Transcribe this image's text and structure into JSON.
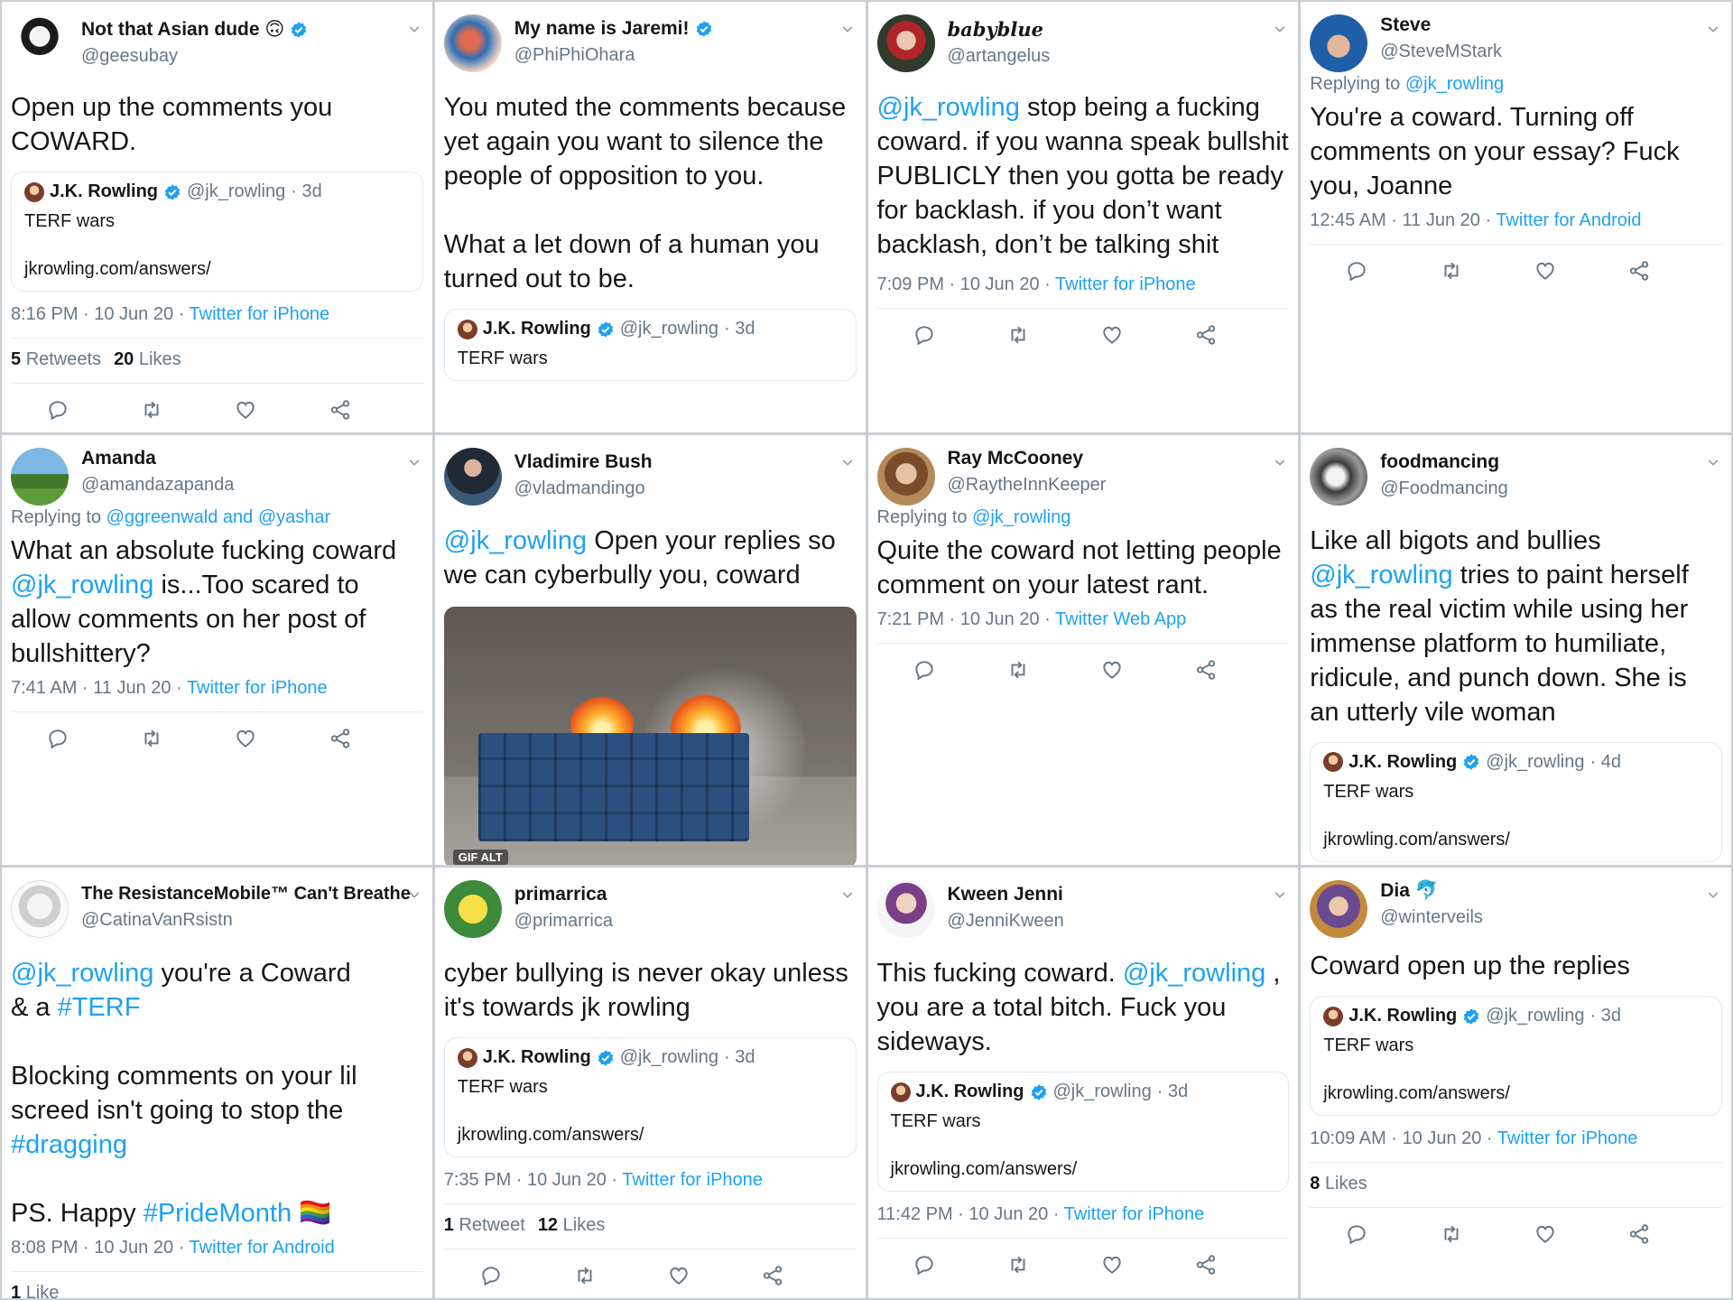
{
  "icons": {
    "verified": "verified-badge-icon",
    "chevron": "chevron-down-icon",
    "reply": "reply-icon",
    "retweet": "retweet-icon",
    "like": "heart-icon",
    "share": "share-icon"
  },
  "colors": {
    "link": "#1da1f2",
    "muted": "#657786",
    "verified": "#1da1f2"
  },
  "quote": {
    "name": "J.K. Rowling",
    "handle": "@jk_rowling",
    "text": "TERF wars",
    "link": "jkrowling.com/answers/"
  },
  "tweets": [
    {
      "name": "Not that Asian dude 🙃",
      "handle": "@geesubay",
      "body": "Open up the comments you COWARD.",
      "quote_meta": " · 3d",
      "time": "8:16 PM · 10 Jun 20 · ",
      "client": "Twitter for iPhone",
      "stat1_num": "5",
      "stat1_label": "Retweets",
      "stat2_num": "20",
      "stat2_label": "Likes"
    },
    {
      "name": "My name is Jaremi!",
      "handle": "@PhiPhiOhara",
      "body": "You muted the comments because yet again you want to silence the people of opposition to you.\n\nWhat a let down of a human you turned out to be.",
      "quote_meta": " · 3d"
    },
    {
      "name": "babyblue",
      "handle": "@artangelus",
      "mention": "@jk_rowling",
      "body": " stop being a fucking coward. if you wanna speak bullshit PUBLICLY then you gotta be ready for backlash. if you don’t want backlash, don’t be talking shit",
      "time": "7:09 PM · 10 Jun 20 · ",
      "client": "Twitter for iPhone"
    },
    {
      "name": "Steve",
      "handle": "@SteveMStark",
      "reply_prefix": "Replying to ",
      "reply_to": "@jk_rowling",
      "body": "You're a coward. Turning off comments on your essay? Fuck you, Joanne",
      "time": "12:45 AM · 11 Jun 20 · ",
      "client": "Twitter for Android"
    },
    {
      "name": "Amanda",
      "handle": "@amandazapanda",
      "reply_prefix": "Replying to ",
      "reply_to": "@ggreenwald and @yashar",
      "body_a": "What an absolute fucking coward ",
      "mention": "@jk_rowling",
      "body_b": " is...Too scared to allow comments on her post of bullshittery?",
      "time": "7:41 AM · 11 Jun 20 · ",
      "client": "Twitter for iPhone"
    },
    {
      "name": "Vladimire Bush",
      "handle": "@vladmandingo",
      "mention": "@jk_rowling",
      "body": " Open your replies so we can cyberbully you, coward",
      "media_badge": "GIF  ALT"
    },
    {
      "name": "Ray McCooney",
      "handle": "@RaytheInnKeeper",
      "reply_prefix": "Replying to ",
      "reply_to": "@jk_rowling",
      "body": "Quite the coward not letting people comment on your latest rant.",
      "time": "7:21 PM · 10 Jun 20 · ",
      "client": "Twitter Web App"
    },
    {
      "name": "foodmancing",
      "handle": "@Foodmancing",
      "body_a": "Like all bigots and bullies ",
      "mention": "@jk_rowling",
      "body_b": " tries to paint herself as the real victim while using her immense platform to humiliate, ridicule, and punch down. She is an utterly vile woman",
      "quote_meta": " · 4d"
    },
    {
      "name": "The ResistanceMobile™ Can't Breathe",
      "handle": "@CatinaVanRsistn",
      "mention": "@jk_rowling",
      "body_a": " you're a Coward\n& a ",
      "tag1": "#TERF",
      "body_b": "\n\nBlocking comments on your lil screed isn't going to stop the\n",
      "tag2": "#dragging",
      "body_c": "\n\nPS. Happy ",
      "tag3": "#PrideMonth",
      "body_d": " 🏳️‍🌈",
      "time": "8:08 PM · 10 Jun 20 · ",
      "client": "Twitter for Android",
      "stat1_num": "1",
      "stat1_label": "Like"
    },
    {
      "name": "primarrica",
      "handle": "@primarrica",
      "body": "cyber bullying is never okay unless it's towards jk rowling",
      "quote_meta": " · 3d",
      "time": "7:35 PM · 10 Jun 20 · ",
      "client": "Twitter for iPhone",
      "stat1_num": "1",
      "stat1_label": "Retweet",
      "stat2_num": "12",
      "stat2_label": "Likes"
    },
    {
      "name": "Kween Jenni",
      "handle": "@JenniKween",
      "body_a": "This fucking coward. ",
      "mention": "@jk_rowling",
      "body_b": " , you are a total bitch. Fuck you sideways.",
      "quote_meta": " · 3d",
      "time": "11:42 PM · 10 Jun 20 · ",
      "client": "Twitter for iPhone"
    },
    {
      "name": "Dia 🐬",
      "handle": "@winterveils",
      "body": "Coward open up the replies",
      "quote_meta": " · 3d",
      "time": "10:09 AM · 10 Jun 20 · ",
      "client": "Twitter for iPhone",
      "stat1_num": "8",
      "stat1_label": "Likes"
    }
  ]
}
